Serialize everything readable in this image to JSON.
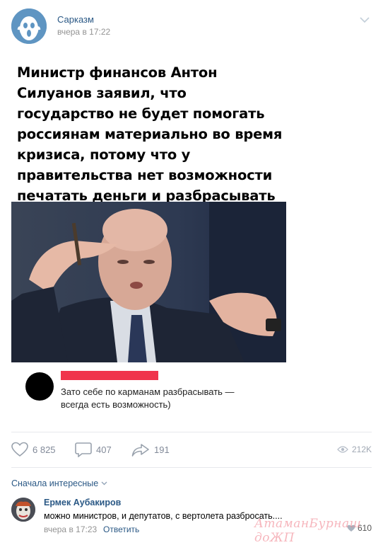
{
  "post": {
    "author": "Сарказм",
    "time": "вчера в 17:22",
    "headline": "Министр финансов Антон Силуанов заявил, что государство не будет помогать россиянам материально во время кризиса, потому что у правительства нет возможности печатать деньги и разбрасывать их с вертолета.",
    "quoted_comment": {
      "line1": "Зато себе по карманам разбрасывать —",
      "line2": "всегда есть возможность)"
    }
  },
  "actions": {
    "likes": "6 825",
    "comments": "407",
    "shares": "191",
    "views": "212K"
  },
  "comments_section": {
    "sort_label": "Сначала интересные"
  },
  "reply": {
    "author": "Ермек Аубакиров",
    "text": "можно министров, и депутатов, с вертолета разбросать....",
    "time": "вчера в 17:23",
    "reply_link": "Ответить",
    "likes": "610"
  },
  "watermark": "АтаманБурнаш доЖП",
  "icons": {
    "menu": "chevron-down-icon",
    "like": "heart-icon",
    "comment": "comment-icon",
    "share": "share-icon",
    "views": "eye-icon"
  },
  "colors": {
    "link": "#2a5885",
    "muted": "#939393",
    "action": "#828a99",
    "red_bar": "#f0344c"
  }
}
